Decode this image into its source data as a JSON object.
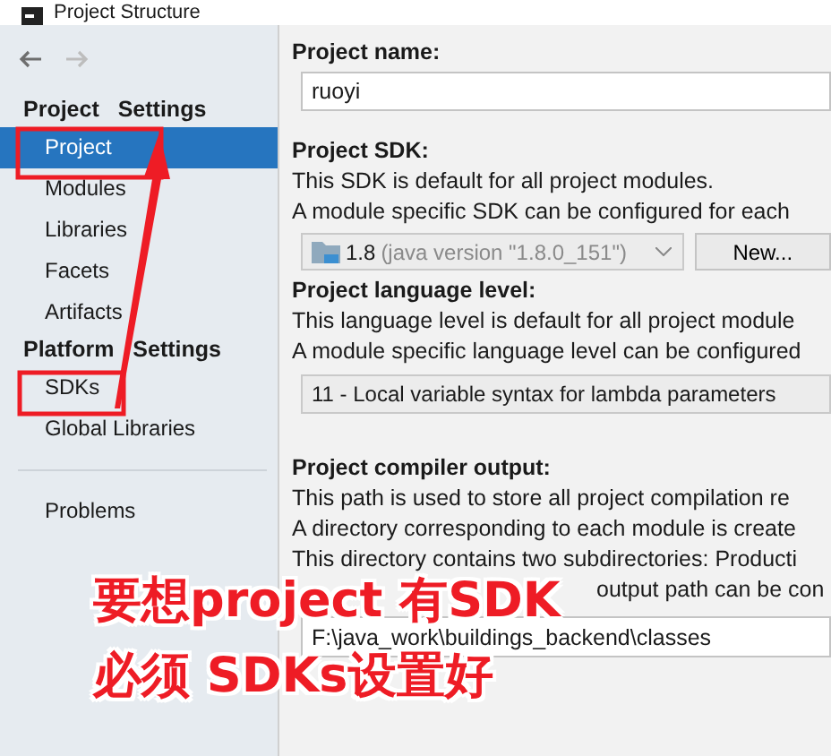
{
  "window": {
    "title": "Project Structure"
  },
  "sidebar": {
    "sections": [
      {
        "heading": "Project Settings",
        "items": [
          {
            "label": "Project",
            "selected": true
          },
          {
            "label": "Modules",
            "selected": false
          },
          {
            "label": "Libraries",
            "selected": false
          },
          {
            "label": "Facets",
            "selected": false
          },
          {
            "label": "Artifacts",
            "selected": false
          }
        ]
      },
      {
        "heading": "Platform Settings",
        "items": [
          {
            "label": "SDKs",
            "selected": false
          },
          {
            "label": "Global Libraries",
            "selected": false
          }
        ]
      }
    ],
    "bottom_items": [
      {
        "label": "Problems",
        "selected": false
      }
    ]
  },
  "project_name": {
    "label": "Project name:",
    "value": "ruoyi"
  },
  "project_sdk": {
    "label": "Project SDK:",
    "lines": [
      "This SDK is default for all project modules.",
      "A module specific SDK can be configured for each"
    ],
    "sdk_version": "1.8",
    "sdk_detail": "(java version \"1.8.0_151\")",
    "button": "New..."
  },
  "language_level": {
    "label": "Project language level:",
    "lines": [
      "This language level is default for all project module",
      "A module specific language level can be configured"
    ],
    "value": "11 - Local variable syntax for lambda parameters"
  },
  "compiler_output": {
    "label": "Project compiler output:",
    "lines": [
      "This path is used to store all project compilation re",
      "A directory corresponding to each module is create",
      "This directory contains two subdirectories: Producti"
    ],
    "covered_line_tail": "output path can be con",
    "value": "F:\\java_work\\buildings_backend\\classes"
  },
  "annotation": {
    "lines": [
      "要想project 有SDK",
      "必须 SDKs设置好"
    ]
  }
}
